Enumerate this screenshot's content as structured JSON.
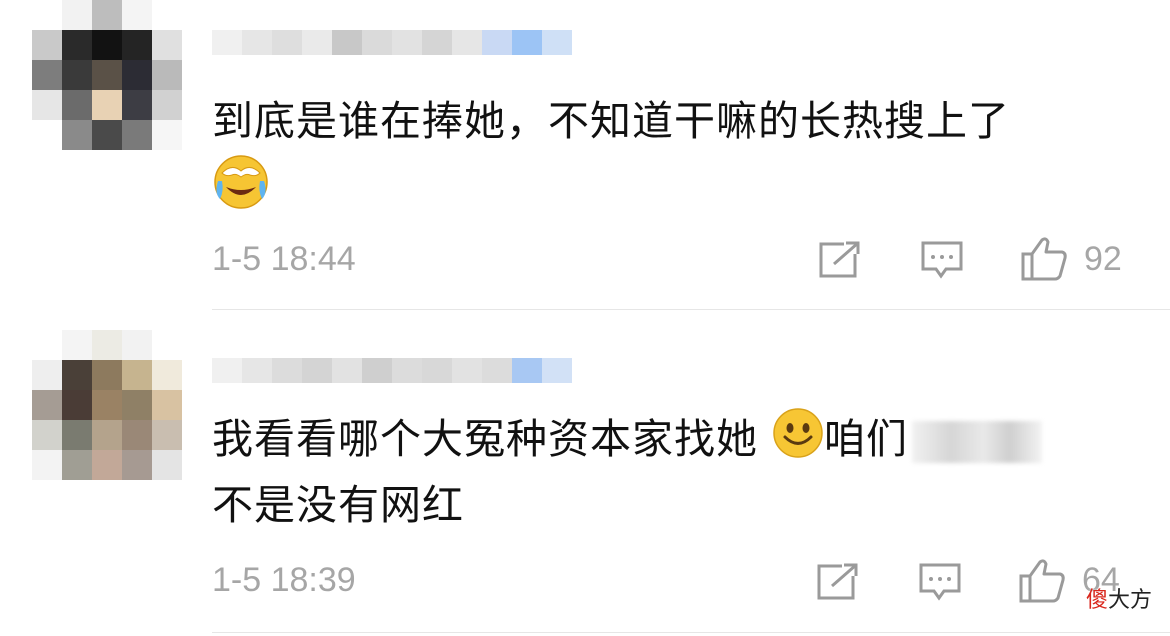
{
  "comments": [
    {
      "text_line1": "到底是谁在捧她，不知道干嘛的长热搜上了",
      "emoji_after_text": "laughing-crying-emoji",
      "time": "1-5 18:44",
      "likes": "92",
      "avatar_colors": [
        "#ffffff",
        "#f2f2f2",
        "#bdbdbd",
        "#f4f4f4",
        "#ffffff",
        "#c9c9c9",
        "#2a2a2a",
        "#121212",
        "#242424",
        "#e0e0e0",
        "#7d7d7d",
        "#3a3a3a",
        "#5a5147",
        "#2c2c34",
        "#bababa",
        "#e6e6e6",
        "#6b6b6b",
        "#e8d2b4",
        "#3d3d44",
        "#d1d1d1",
        "#ffffff",
        "#8a8a8a",
        "#4a4a4a",
        "#7a7a7a",
        "#f6f6f6"
      ],
      "username_colors": [
        "#f0f0f0",
        "#e6e6e6",
        "#dedede",
        "#eaeaea",
        "#c8c8c8",
        "#dadada",
        "#e2e2e2",
        "#d5d5d5",
        "#e6e6e6",
        "#c9d9f4",
        "#9cc4f5",
        "#cfe0f6"
      ]
    },
    {
      "text_line1": "我看看哪个大冤种资本家找她",
      "text_line1_after": "咱们",
      "text_line2": "不是没有网红",
      "emoji_after_text": "smiley-emoji",
      "time": "1-5 18:39",
      "likes": "64",
      "avatar_colors": [
        "#ffffff",
        "#f4f4f4",
        "#ecebe4",
        "#f2f2f2",
        "#ffffff",
        "#eeeeee",
        "#4a4038",
        "#8d7a5e",
        "#c6b48f",
        "#f0eadc",
        "#a59c94",
        "#4a3c36",
        "#9a8264",
        "#8f8066",
        "#d8c2a2",
        "#d2d2cc",
        "#7a7b70",
        "#b4a38c",
        "#9a8877",
        "#c9beb0",
        "#f3f3f3",
        "#a09e94",
        "#c2a898",
        "#a69a92",
        "#e4e4e4"
      ],
      "username_colors": [
        "#f0f0f0",
        "#e6e6e6",
        "#dcdcdc",
        "#d4d4d4",
        "#e2e2e2",
        "#cfcfcf",
        "#dcdcdc",
        "#d8d8d8",
        "#e2e2e2",
        "#dcdcdc",
        "#a8c8f3",
        "#d2e1f6"
      ]
    }
  ],
  "colors": {
    "text": "#111111",
    "meta": "#a6a6a6",
    "icon": "#9a9a9a",
    "divider": "#e6e6e6"
  },
  "icons": {
    "repost": "repost-icon",
    "comment": "comment-icon",
    "like": "like-icon"
  },
  "watermark": {
    "a": "傻",
    "b": "大方"
  }
}
